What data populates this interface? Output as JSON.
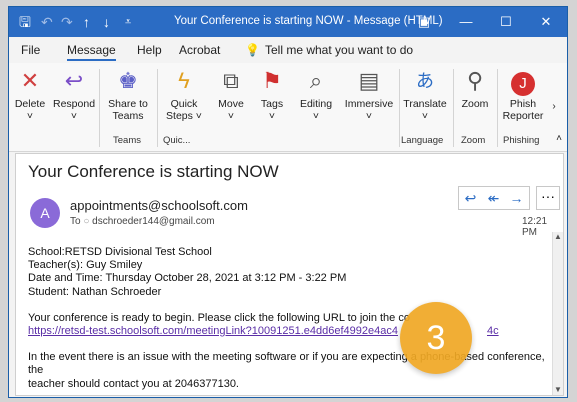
{
  "titlebar": {
    "title": "Your Conference is starting NOW  -  Message (HTML)"
  },
  "menu": {
    "items": [
      "File",
      "Message",
      "Help",
      "Acrobat"
    ],
    "tell_me": "Tell me what you want to do"
  },
  "ribbon": {
    "buttons": [
      {
        "label": "Delete"
      },
      {
        "label": "Respond"
      },
      {
        "label": "Share to Teams"
      },
      {
        "label": "Quick Steps"
      },
      {
        "label": "Move"
      },
      {
        "label": "Tags"
      },
      {
        "label": "Editing"
      },
      {
        "label": "Immersive"
      },
      {
        "label": "Translate"
      },
      {
        "label": "Zoom"
      },
      {
        "label": "Phish Reporter"
      }
    ],
    "groups": [
      "Teams",
      "Quic...",
      "Language",
      "Zoom",
      "Phishing"
    ]
  },
  "email": {
    "subject": "Your Conference is starting NOW",
    "avatar_initial": "A",
    "from": "appointments@schoolsoft.com",
    "to_label": "To",
    "to": "dschroeder144@gmail.com",
    "time": "12:21 PM",
    "body": {
      "school": "School:RETSD Divisional Test School",
      "teachers": "Teacher(s): Guy Smiley",
      "datetime": "Date and Time: Thursday October 28, 2021 at 3:12 PM - 3:22 PM",
      "student": "Student: Nathan Schroeder",
      "ready": "Your conference is ready to begin. Please click the following URL to join the co",
      "link": "https://retsd-test.schoolsoft.com/meetingLink?10091251.e4dd6ef4992e4ac4",
      "link_end": "4c",
      "issue_a": "In the event there is an issue with the meeting software or if you are expecting a phone-based conference, the",
      "issue_b": "teacher should contact you at 2046377130."
    }
  },
  "overlay": {
    "step_number": "3"
  },
  "colors": {
    "titlebar": "#2b6cc4",
    "badge": "#f0a824",
    "avatar": "#8a6ad8",
    "link": "#5a2ea6"
  }
}
